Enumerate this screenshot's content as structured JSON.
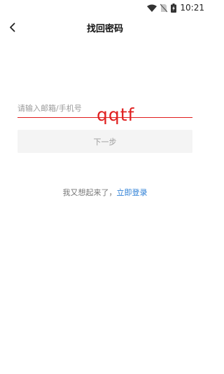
{
  "status_bar": {
    "time": "10:21",
    "icons": [
      "wifi-icon",
      "no-sim-icon",
      "battery-charging-icon"
    ]
  },
  "nav": {
    "back_icon": "chevron-left-icon",
    "title": "找回密码"
  },
  "form": {
    "account_placeholder": "请输入邮箱/手机号",
    "account_value": "",
    "handwritten_text": "qqtf",
    "next_label": "下一步"
  },
  "footer": {
    "prompt": "我又想起来了，",
    "login_link": "立即登录"
  },
  "colors": {
    "underline": "#e11d1d",
    "handwriting": "#e02020",
    "link": "#2d7fd6",
    "button_bg": "#f4f4f4"
  }
}
